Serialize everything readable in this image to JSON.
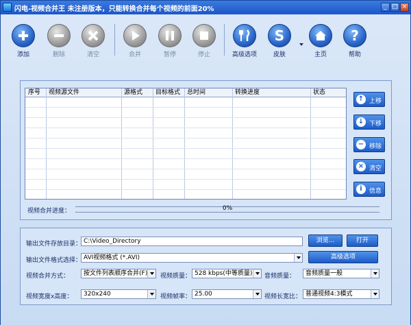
{
  "window": {
    "title": "闪电-视频合并王  未注册版本，只能转换合并每个视频的前面20%",
    "min": "_",
    "max": "□",
    "close": "×"
  },
  "toolbar": {
    "add": "添加",
    "remove": "删除",
    "clear": "清空",
    "merge": "合并",
    "pause": "暂停",
    "stop": "停止",
    "advanced": "高级选项",
    "skin": "皮肤",
    "home": "主页",
    "help": "帮助"
  },
  "table": {
    "headers": [
      "序号",
      "视频源文件",
      "源格式",
      "目标格式",
      "总时间",
      "转换进度",
      "状态"
    ]
  },
  "side_buttons": {
    "up": "上移",
    "down": "下移",
    "remove": "移除",
    "clear": "清空",
    "info": "信息"
  },
  "progress": {
    "label": "视频合并进度：",
    "value": 0,
    "text": "0%"
  },
  "output": {
    "dir_label": "输出文件存放目录：",
    "dir_value": "C:\\Video_Directory",
    "browse": "浏览...",
    "open": "打开",
    "format_label": "输出文件格式选择：",
    "format_value": "AVI视频格式 (*.AVI)",
    "advanced": "高级选项",
    "merge_label": "视频合并方式：",
    "merge_value": "按文件列表顺序合并(F)",
    "vrate_label": "视频质量：",
    "vrate_value": "528 kbps(中等质量)",
    "aq_label": "音频质量：",
    "aq_value": "音频质量一般",
    "size_label": "视频宽度x高度：",
    "size_value": "320x240",
    "fps_label": "视频帧率：",
    "fps_value": "25.00",
    "ratio_label": "视频长宽比：",
    "ratio_value": "普通视频4:3模式"
  }
}
